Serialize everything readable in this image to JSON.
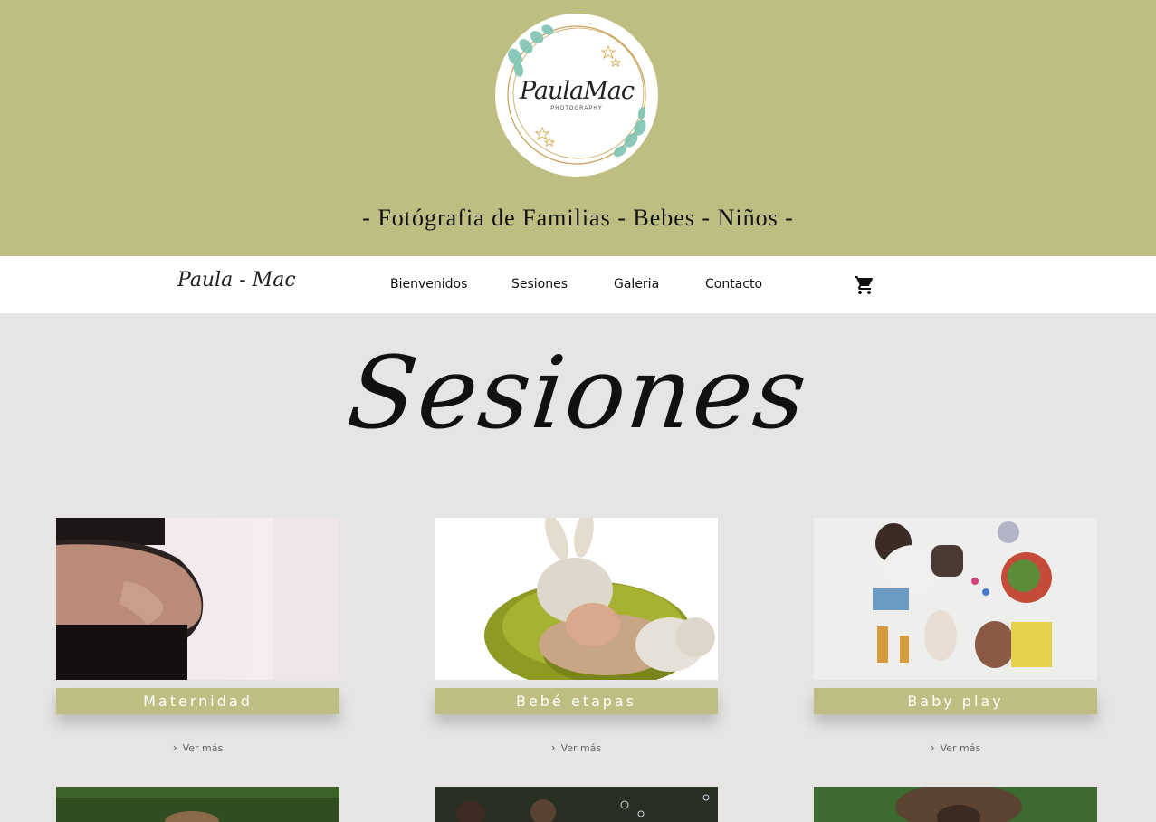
{
  "header": {
    "logo": {
      "name": "PaulaMac",
      "sub": "PHOTOGRAPHY"
    },
    "tagline": "- Fotógrafia de Familias - Bebes - Niños -"
  },
  "nav": {
    "brand": "Paula - Mac",
    "links": [
      "Bienvenidos",
      "Sesiones",
      "Galeria",
      "Contacto"
    ],
    "cart_icon": "shopping-cart-icon"
  },
  "page_title": "Sesiones",
  "sessions": [
    {
      "label": "Maternidad",
      "more": "Ver más"
    },
    {
      "label": "Bebé etapas",
      "more": "Ver más"
    },
    {
      "label": "Baby play",
      "more": "Ver más"
    }
  ],
  "colors": {
    "accent": "#bebe82",
    "background": "#e6e5e3"
  }
}
